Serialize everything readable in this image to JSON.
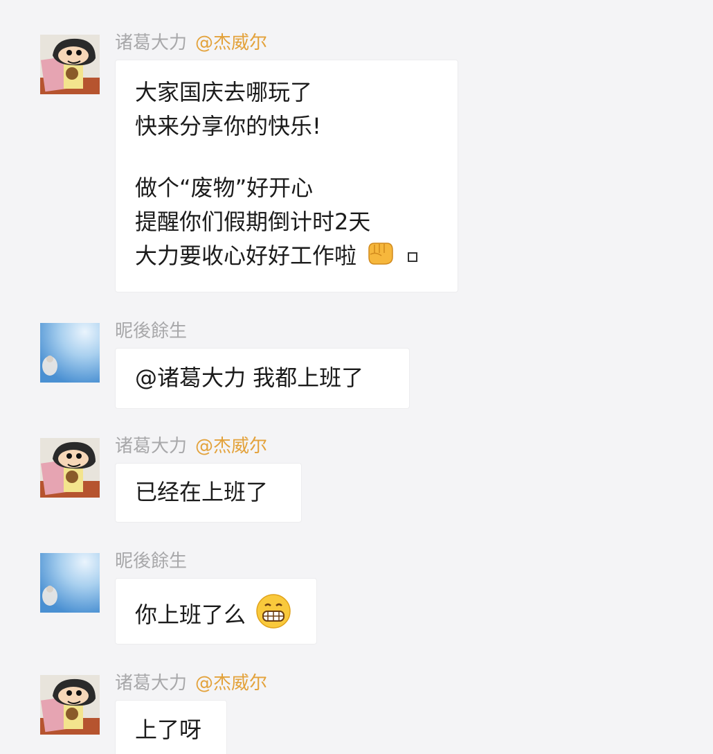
{
  "messages": [
    {
      "avatar": "cartoon-boy-avatar",
      "sender": "诸葛大力",
      "tag": "@杰威尔",
      "lines": [
        "大家国庆去哪玩了",
        "快来分享你的快乐!",
        "",
        "做个“废物”好开心",
        "提醒你们假期倒计时2天",
        "大力要收心好好工作啦"
      ],
      "trailing": [
        "fist-emoji",
        "box-glyph"
      ]
    },
    {
      "avatar": "blue-sky-avatar",
      "sender": "昵後餘生",
      "lines": [
        "@诸葛大力 我都上班了"
      ]
    },
    {
      "avatar": "cartoon-boy-avatar",
      "sender": "诸葛大力",
      "tag": "@杰威尔",
      "lines": [
        "已经在上班了"
      ]
    },
    {
      "avatar": "blue-sky-avatar",
      "sender": "昵後餘生",
      "lines": [
        "你上班了么"
      ],
      "trailing": [
        "grin-emoji"
      ]
    },
    {
      "avatar": "cartoon-boy-avatar",
      "sender": "诸葛大力",
      "tag": "@杰威尔",
      "lines": [
        "上了呀"
      ]
    }
  ]
}
